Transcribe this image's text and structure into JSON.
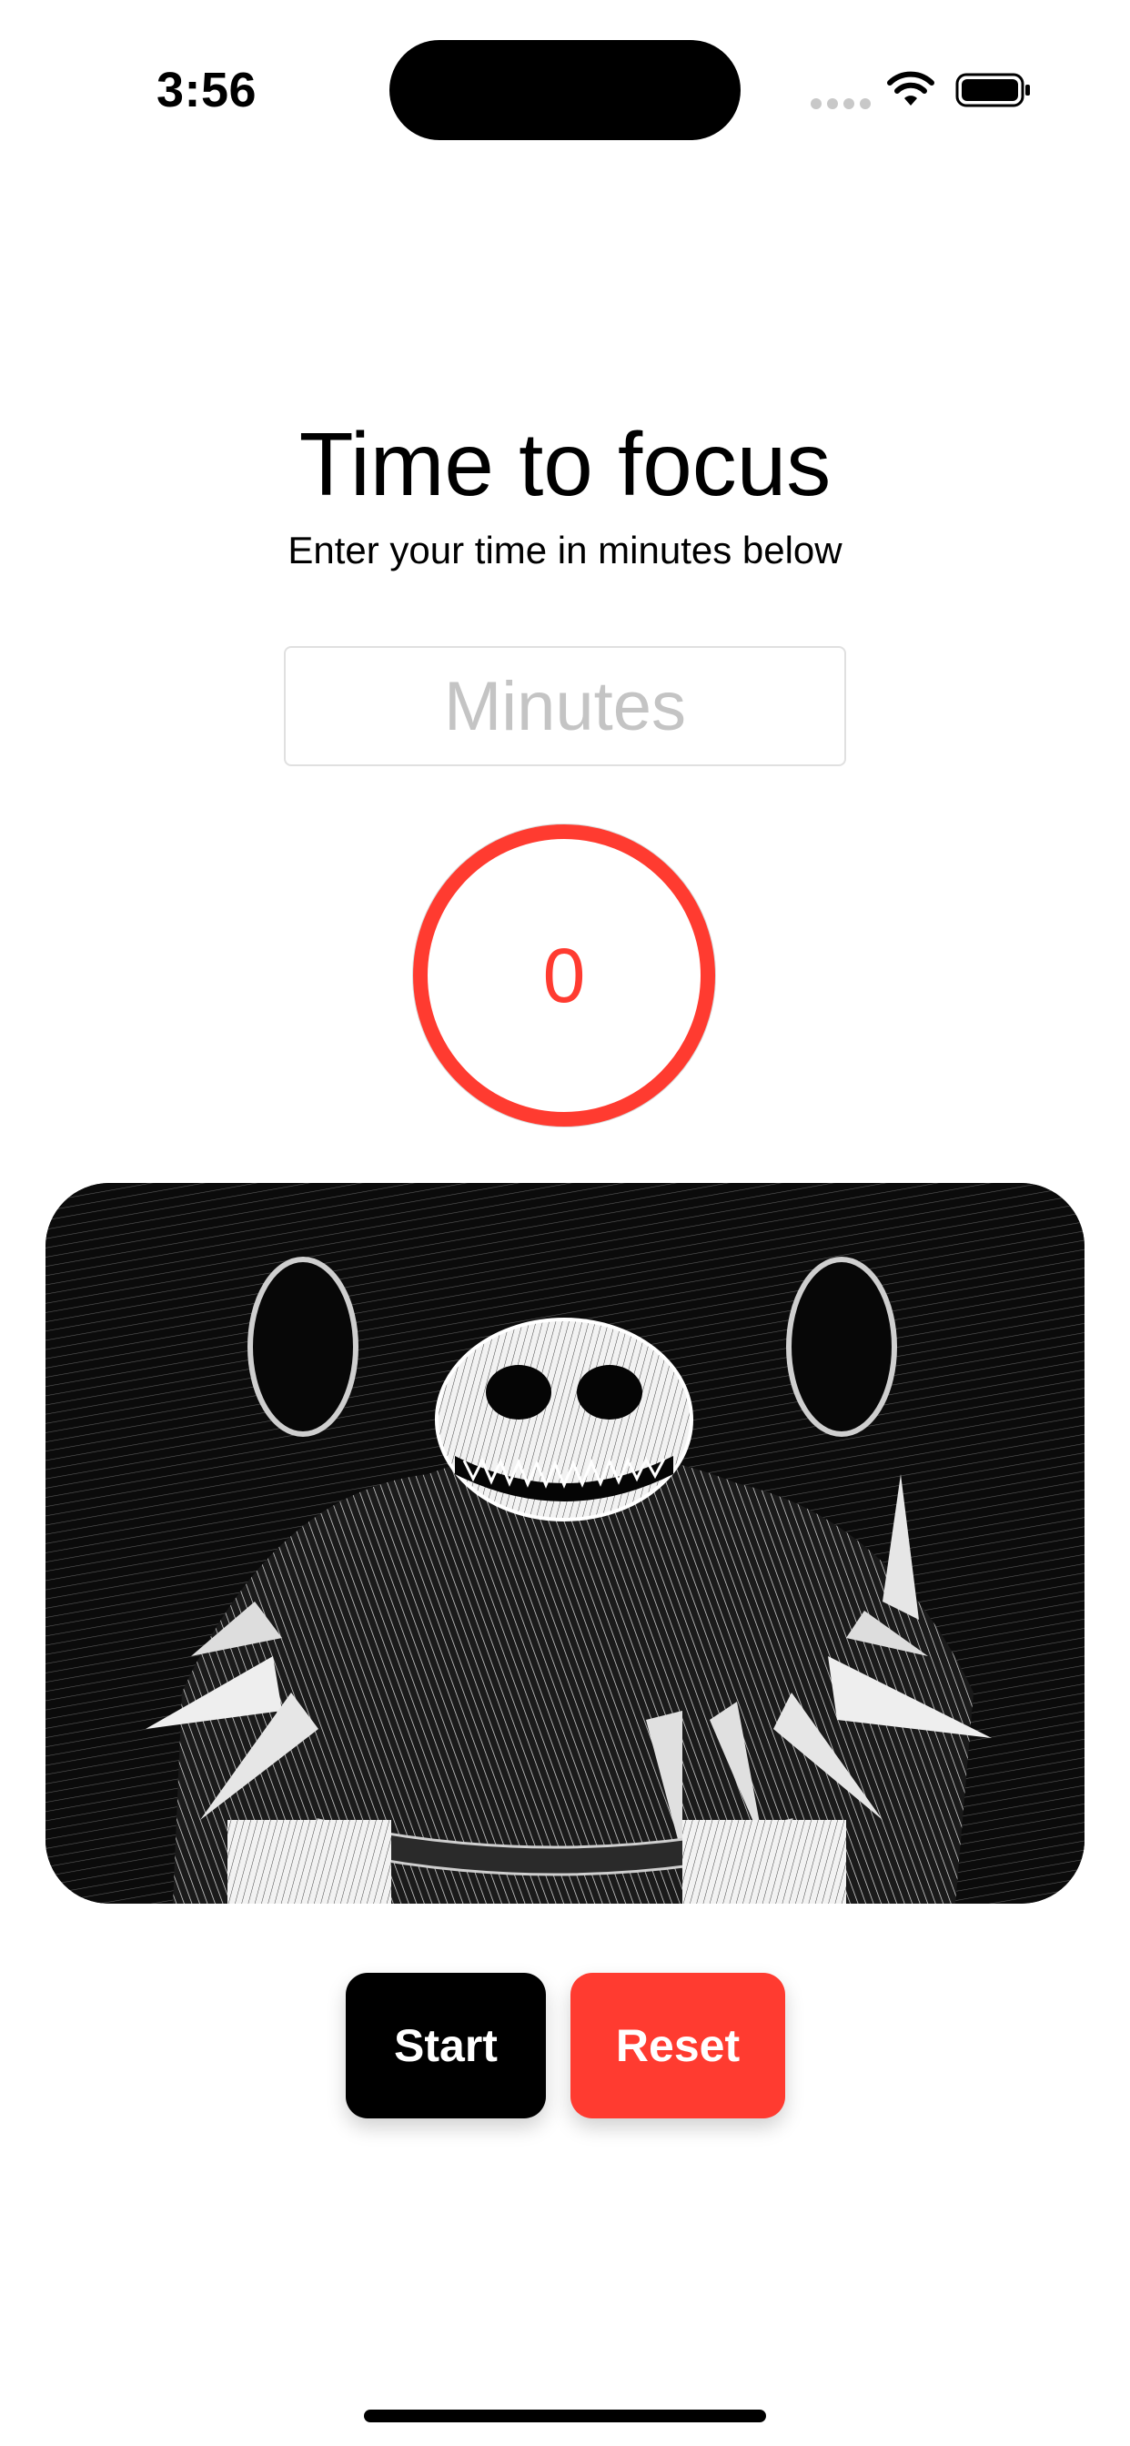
{
  "status_bar": {
    "time": "3:56",
    "icons": [
      "signal-dots-icon",
      "wifi-icon",
      "battery-icon"
    ]
  },
  "header": {
    "title": "Time to focus",
    "subtitle": "Enter your time in minutes below"
  },
  "minutes_input": {
    "value": "",
    "placeholder": "Minutes"
  },
  "timer": {
    "value": "0",
    "ring_color": "#ff3b30",
    "track_color": "#d9d9d9"
  },
  "artwork": {
    "subject": "black-and-white ink illustration of a spiky-shelled creature"
  },
  "actions": {
    "start_label": "Start",
    "reset_label": "Reset"
  },
  "colors": {
    "accent": "#ff3b30",
    "primary_button": "#000000",
    "background": "#ffffff"
  }
}
